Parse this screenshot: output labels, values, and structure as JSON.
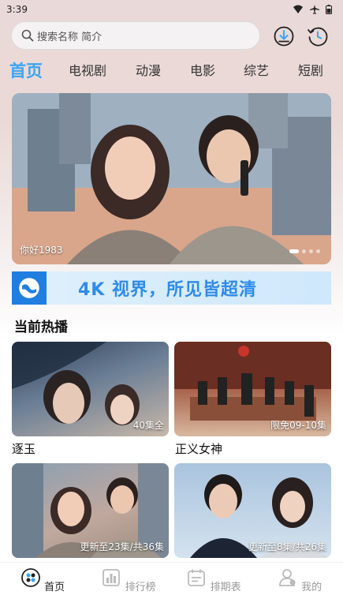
{
  "status_bar": {
    "time": "3:39"
  },
  "search": {
    "placeholder": "搜索名称 简介"
  },
  "tabs": [
    {
      "label": "首页"
    },
    {
      "label": "电视剧"
    },
    {
      "label": "动漫"
    },
    {
      "label": "电影"
    },
    {
      "label": "综艺"
    },
    {
      "label": "短剧"
    }
  ],
  "hero": {
    "caption": "你好1983"
  },
  "banner": {
    "text": "4K 视界，所见皆超清"
  },
  "section": {
    "title": "当前热播"
  },
  "cards": [
    {
      "title": "逐玉",
      "badge": "40集全"
    },
    {
      "title": "正义女神",
      "badge": "限免09-10集"
    },
    {
      "title": "",
      "badge": "更新至23集/共36集"
    },
    {
      "title": "",
      "badge": "更新至8集/共26集"
    }
  ],
  "nav": [
    {
      "label": "首页"
    },
    {
      "label": "排行榜"
    },
    {
      "label": "排期表"
    },
    {
      "label": "我的"
    }
  ],
  "colors": {
    "accent": "#3ba4f4",
    "text": "#1a1a1a",
    "muted": "#9a9a9a"
  }
}
